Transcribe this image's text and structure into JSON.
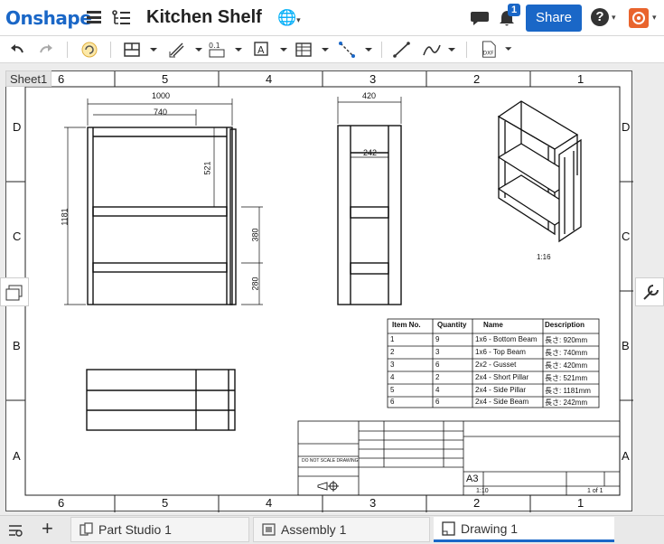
{
  "app": {
    "logo": "Onshape",
    "document_title": "Kitchen Shelf"
  },
  "header": {
    "notification_count": "1",
    "share_label": "Share",
    "help_label": "?"
  },
  "sheet": {
    "tab_label": "Sheet1"
  },
  "drawing": {
    "border_columns": [
      "6",
      "5",
      "4",
      "3",
      "2",
      "1"
    ],
    "border_rows": [
      "D",
      "C",
      "B",
      "A"
    ],
    "front_view_dims": {
      "overall_width": "1000",
      "inner_width": "740",
      "height": "1181",
      "pillar": "521",
      "gap1": "380",
      "gap2": "280"
    },
    "side_view_dims": {
      "depth": "420",
      "beam": "242"
    },
    "iso_scale": "1:16",
    "bom": {
      "headers": [
        "Item No.",
        "Quantity",
        "Name",
        "Description"
      ],
      "rows": [
        [
          "1",
          "9",
          "1x6 - Bottom Beam",
          "長さ: 920mm"
        ],
        [
          "2",
          "3",
          "1x6 - Top Beam",
          "長さ: 740mm"
        ],
        [
          "3",
          "6",
          "2x2 - Gusset",
          "長さ: 420mm"
        ],
        [
          "4",
          "2",
          "2x4 - Short Pillar",
          "長さ: 521mm"
        ],
        [
          "5",
          "4",
          "2x4 - Side Pillar",
          "長さ: 1181mm"
        ],
        [
          "6",
          "6",
          "2x4 - Side Beam",
          "長さ: 242mm"
        ]
      ]
    },
    "title_block": {
      "size": "A3",
      "scale": "1:10",
      "sheet": "1 of 1",
      "do_not_scale": "DO NOT SCALE DRAWING"
    }
  },
  "tabs": [
    {
      "label": "Part Studio 1"
    },
    {
      "label": "Assembly 1"
    },
    {
      "label": "Drawing 1"
    }
  ],
  "colors": {
    "accent": "#1a67c7",
    "user": "#e9642d"
  }
}
